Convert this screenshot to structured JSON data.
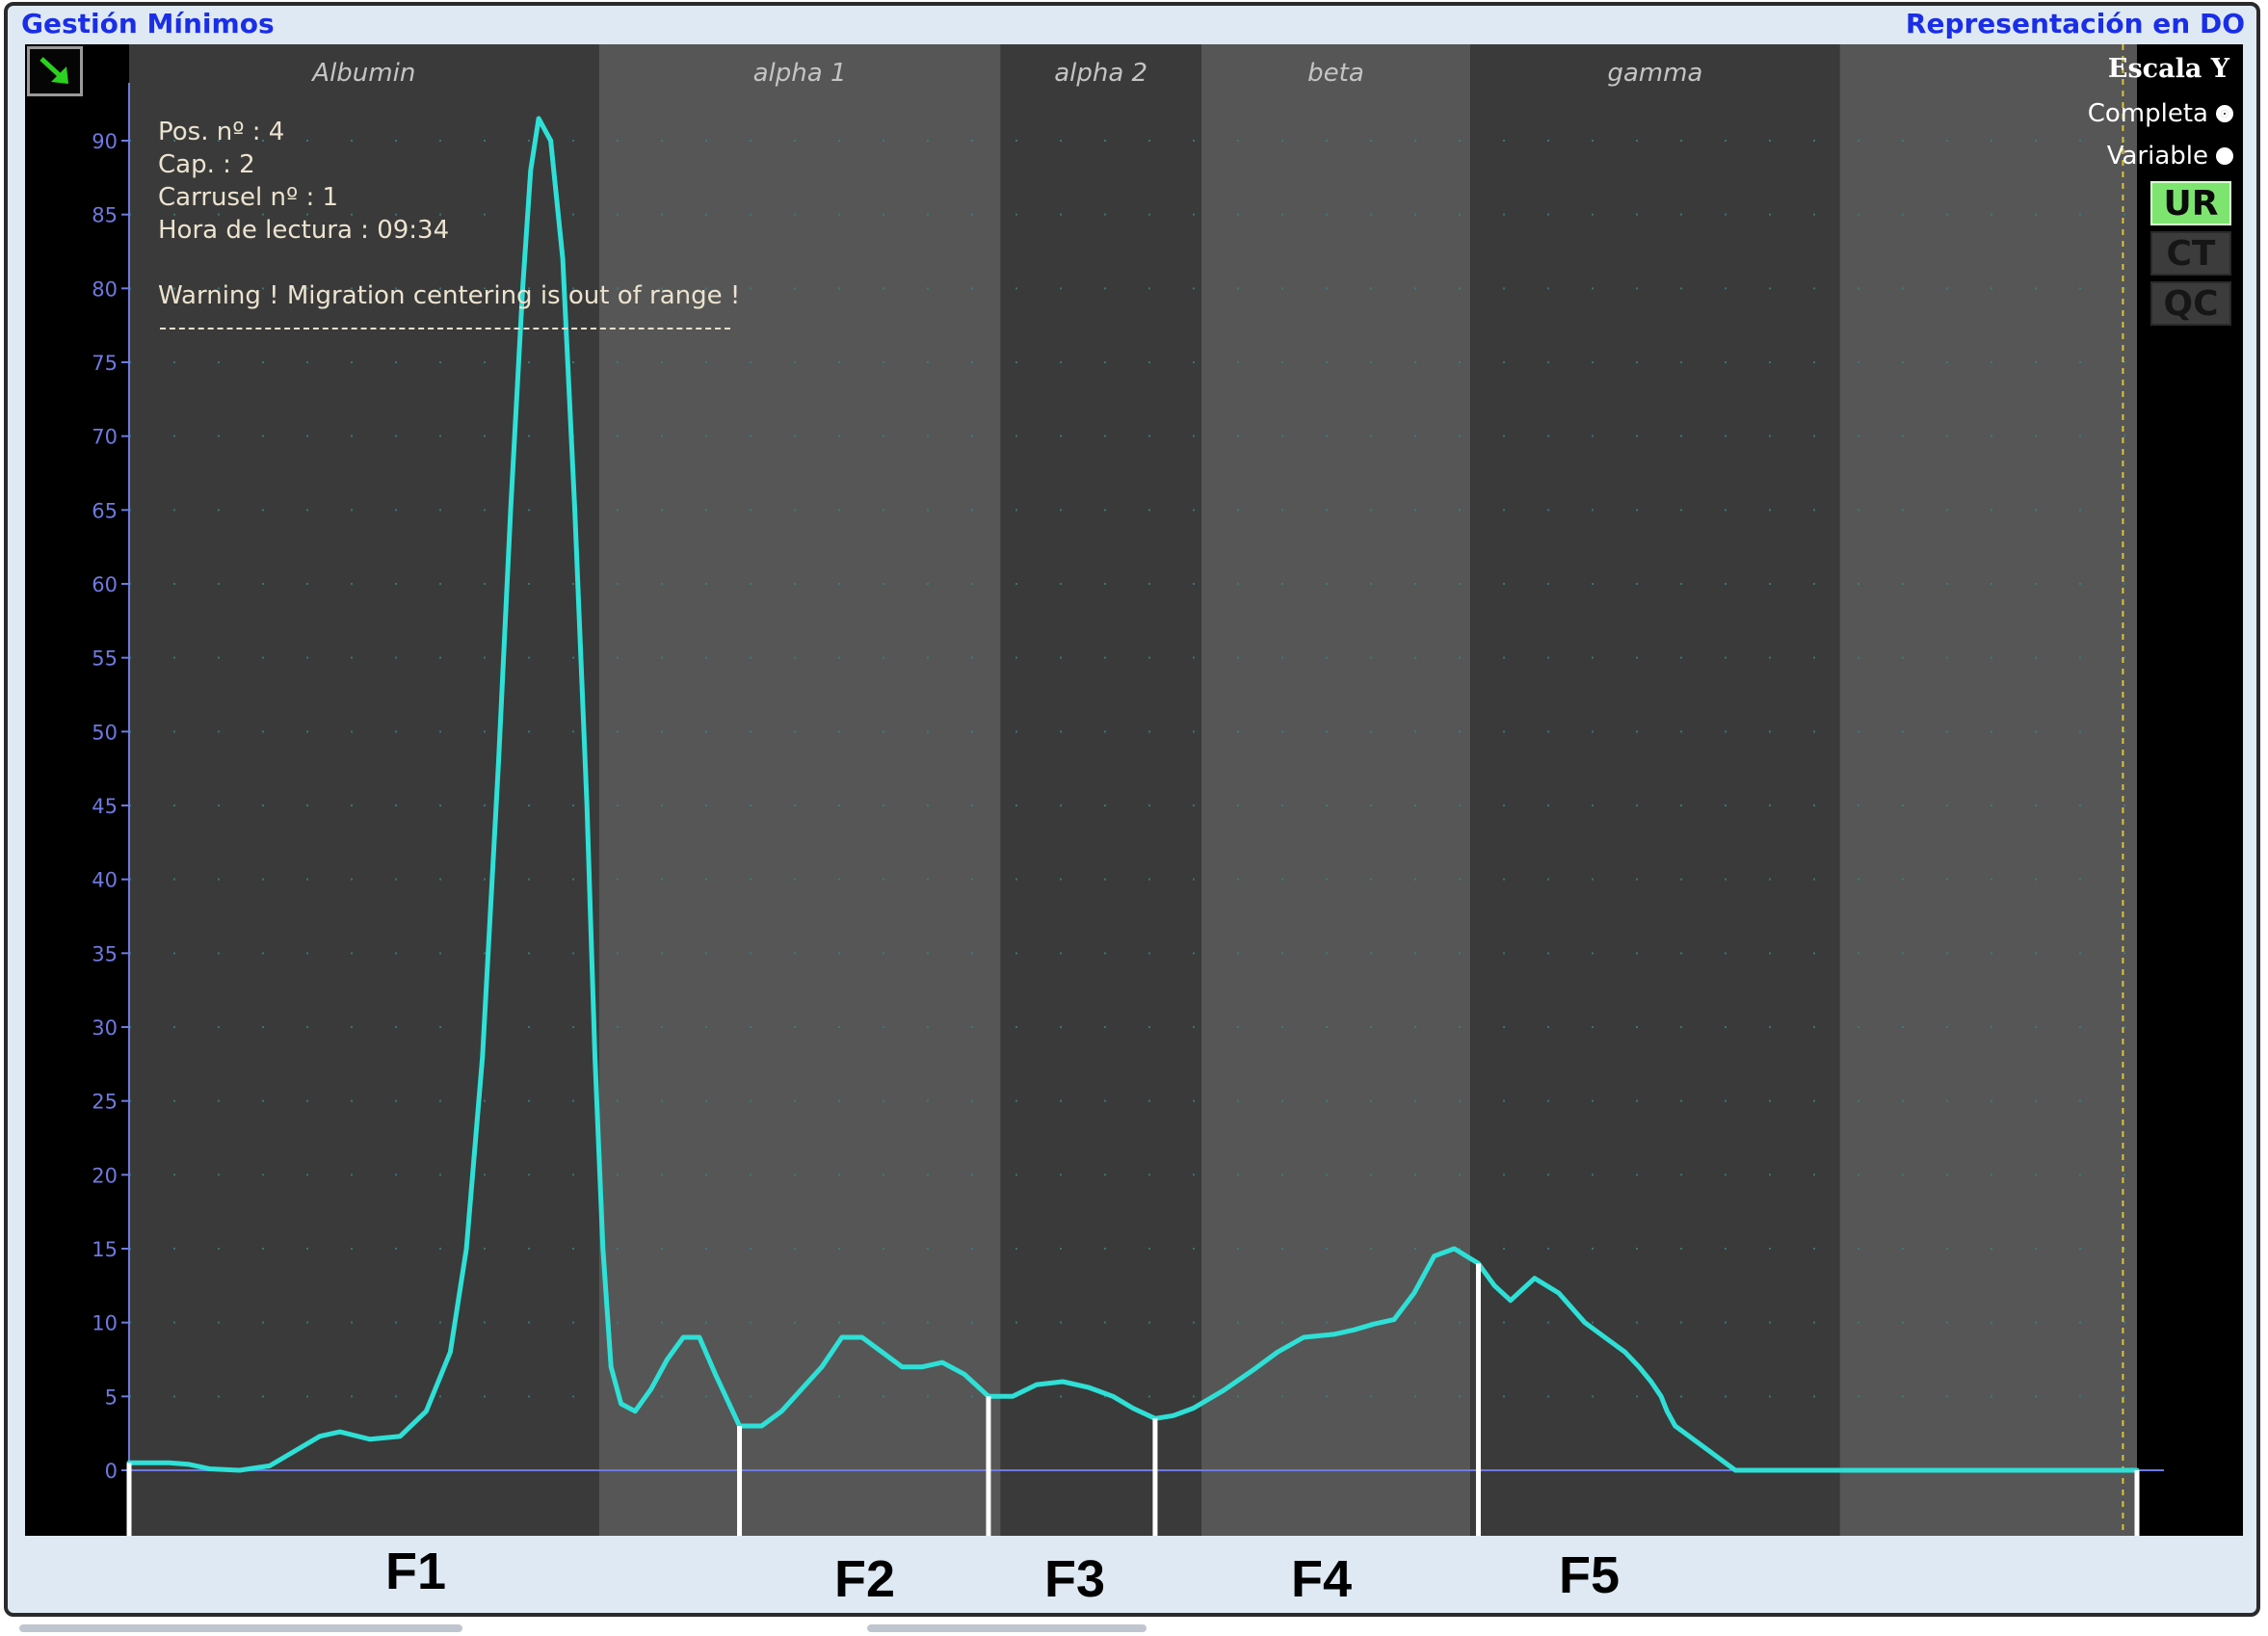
{
  "window": {
    "title_left": "Gestión Mínimos",
    "title_right": "Representación en DO"
  },
  "info": {
    "position": "Pos. nº : 4",
    "capillary": "Cap. : 2",
    "carousel": "Carrusel nº : 1",
    "read_time": "Hora de lectura : 09:34",
    "warning": "Warning !   Migration centering is out of range !"
  },
  "scale_panel": {
    "title": "Escala Y",
    "options": [
      {
        "label": "Completa",
        "selected": true
      },
      {
        "label": "Variable",
        "selected": false
      }
    ]
  },
  "mode_buttons": [
    {
      "label": "UR",
      "active": true
    },
    {
      "label": "CT",
      "active": false
    },
    {
      "label": "QC",
      "active": false
    }
  ],
  "fraction_labels": [
    "F1",
    "F2",
    "F3",
    "F4",
    "F5"
  ],
  "icons": {
    "corner_button": "arrow-down-right-icon"
  },
  "colors": {
    "curve": "#2ee0d6",
    "band_dark": "#3a3a3a",
    "band_light": "#565656",
    "axis": "#6f79e0",
    "title_blue": "#1a2ee8",
    "ur_active": "#7de56f"
  },
  "chart_data": {
    "type": "line",
    "title": "",
    "xlabel": "",
    "ylabel": "",
    "ylim": [
      0,
      95
    ],
    "yticks": [
      0,
      5,
      10,
      15,
      20,
      25,
      30,
      35,
      40,
      45,
      50,
      55,
      60,
      65,
      70,
      75,
      80,
      85,
      90
    ],
    "xlim": [
      0,
      1
    ],
    "grid": "dotted",
    "zones": [
      {
        "name": "Albumin",
        "start": 0.0,
        "end": 0.234
      },
      {
        "name": "alpha 1",
        "start": 0.234,
        "end": 0.434
      },
      {
        "name": "alpha 2",
        "start": 0.434,
        "end": 0.534
      },
      {
        "name": "beta",
        "start": 0.534,
        "end": 0.668
      },
      {
        "name": "gamma",
        "start": 0.668,
        "end": 0.852
      },
      {
        "name": "",
        "start": 0.852,
        "end": 1.0
      }
    ],
    "fraction_cuts": [
      0.0,
      0.304,
      0.428,
      0.511,
      0.672,
      1.0
    ],
    "limit_marker": 0.993,
    "series": [
      {
        "x": [
          0.0,
          0.02,
          0.03,
          0.04,
          0.055,
          0.07,
          0.085,
          0.095,
          0.105,
          0.12,
          0.135,
          0.148,
          0.16,
          0.168,
          0.176,
          0.184,
          0.19,
          0.196,
          0.2,
          0.204,
          0.21,
          0.216,
          0.222,
          0.228,
          0.232,
          0.236,
          0.24,
          0.245,
          0.252,
          0.26,
          0.268,
          0.276,
          0.284,
          0.292,
          0.304,
          0.315,
          0.325,
          0.335,
          0.345,
          0.355,
          0.365,
          0.375,
          0.385,
          0.395,
          0.405,
          0.416,
          0.428,
          0.44,
          0.452,
          0.465,
          0.478,
          0.49,
          0.5,
          0.511,
          0.52,
          0.53,
          0.545,
          0.56,
          0.572,
          0.585,
          0.6,
          0.61,
          0.62,
          0.63,
          0.64,
          0.65,
          0.66,
          0.672,
          0.68,
          0.688,
          0.7,
          0.712,
          0.725,
          0.735,
          0.745,
          0.752,
          0.758,
          0.763,
          0.766,
          0.77,
          0.8,
          0.85,
          0.9,
          0.95,
          0.99,
          1.0
        ],
        "y": [
          0.5,
          0.5,
          0.4,
          0.1,
          0.0,
          0.3,
          1.5,
          2.3,
          2.6,
          2.1,
          2.3,
          4.0,
          8.0,
          15.0,
          28.0,
          48.0,
          65.0,
          80.0,
          88.0,
          91.5,
          90.0,
          82.0,
          65.0,
          45.0,
          28.0,
          15.0,
          7.0,
          4.5,
          4.0,
          5.5,
          7.5,
          9.0,
          9.0,
          6.5,
          3.0,
          3.0,
          4.0,
          5.5,
          7.0,
          9.0,
          9.0,
          8.0,
          7.0,
          7.0,
          7.3,
          6.5,
          5.0,
          5.0,
          5.8,
          6.0,
          5.6,
          5.0,
          4.2,
          3.5,
          3.7,
          4.2,
          5.4,
          6.8,
          8.0,
          9.0,
          9.2,
          9.5,
          9.9,
          10.2,
          12.0,
          14.5,
          15.0,
          14.0,
          12.5,
          11.5,
          13.0,
          12.0,
          10.0,
          9.0,
          8.0,
          7.0,
          6.0,
          5.0,
          4.0,
          3.0,
          0.0,
          0.0,
          0.0,
          0.0,
          0.0,
          0.0
        ]
      }
    ]
  }
}
